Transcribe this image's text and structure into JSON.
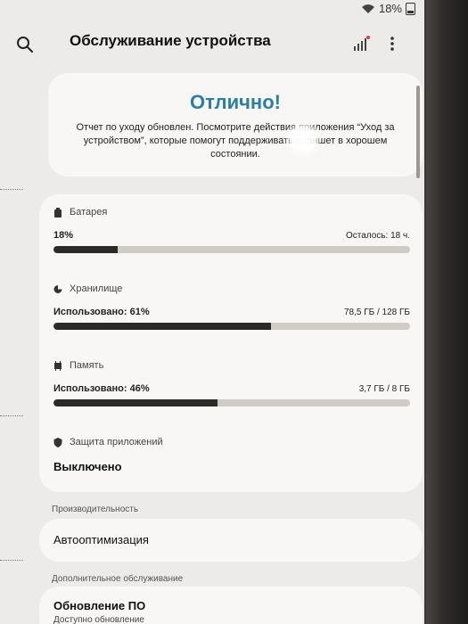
{
  "status_bar": {
    "battery": "18%"
  },
  "header": {
    "title": "Обслуживание устройства"
  },
  "status_card": {
    "title": "Отлично!",
    "text": "Отчет по уходу обновлен. Посмотрите действия приложения “Уход за устройством”, которые помогут поддерживать планшет в хорошем состоянии."
  },
  "battery": {
    "label": "Батарея",
    "percent_text": "18%",
    "remaining": "Осталось: 18 ч.",
    "level": 0.18
  },
  "storage": {
    "label": "Хранилище",
    "used_text": "Использовано: 61%",
    "amount": "78,5 ГБ / 128 ГБ",
    "level": 0.61
  },
  "memory": {
    "label": "Память",
    "used_text": "Использовано: 46%",
    "amount": "3,7 ГБ / 8 ГБ",
    "level": 0.46
  },
  "app_protection": {
    "label": "Защита приложений",
    "value": "Выключено"
  },
  "performance": {
    "group_label": "Производительность",
    "item": "Автооптимизация"
  },
  "additional": {
    "group_label": "Дополнительное обслуживание",
    "item": "Обновление ПО",
    "sub": "Доступно обновление"
  },
  "icons": {
    "search": "search-icon",
    "signal": "signal-bars-icon",
    "more": "more-vertical-icon",
    "battery": "battery-icon",
    "storage": "storage-icon",
    "memory": "memory-chip-icon",
    "shield": "shield-icon"
  },
  "colors": {
    "accent_title": "#2a7fa8",
    "bar_fill": "#2c2a28",
    "bar_track": "#cfcbc7",
    "signal_dot": "#e23b3b"
  }
}
